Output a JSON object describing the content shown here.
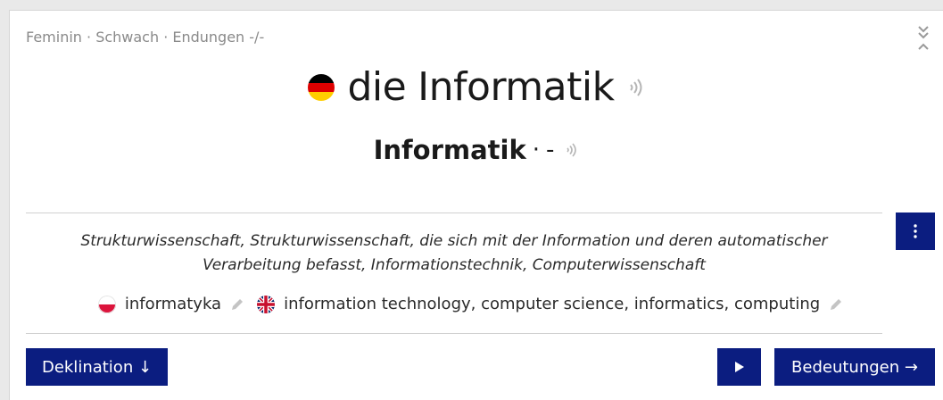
{
  "grammar_info": "Feminin · Schwach · Endungen -/-",
  "headword": {
    "flag": "flag-germany-icon",
    "article": "die",
    "noun": "Informatik"
  },
  "forms": {
    "genitive": "Informatik",
    "separator": "·",
    "plural": "-"
  },
  "definition": {
    "line1": "Strukturwissenschaft, Strukturwissenschaft, die sich mit der Information und deren automatischer",
    "line2": "Verarbeitung befasst, Informationstechnik, Computerwissenschaft"
  },
  "translations": [
    {
      "flag": "flag-poland-icon",
      "text": "informatyka"
    },
    {
      "flag": "flag-uk-icon",
      "text": "information technology, computer science, informatics, computing"
    }
  ],
  "buttons": {
    "declension": "Deklination ↓",
    "meanings": "Bedeutungen →"
  },
  "colors": {
    "primary": "#0b1d80",
    "muted_text": "#8a8a8a"
  }
}
